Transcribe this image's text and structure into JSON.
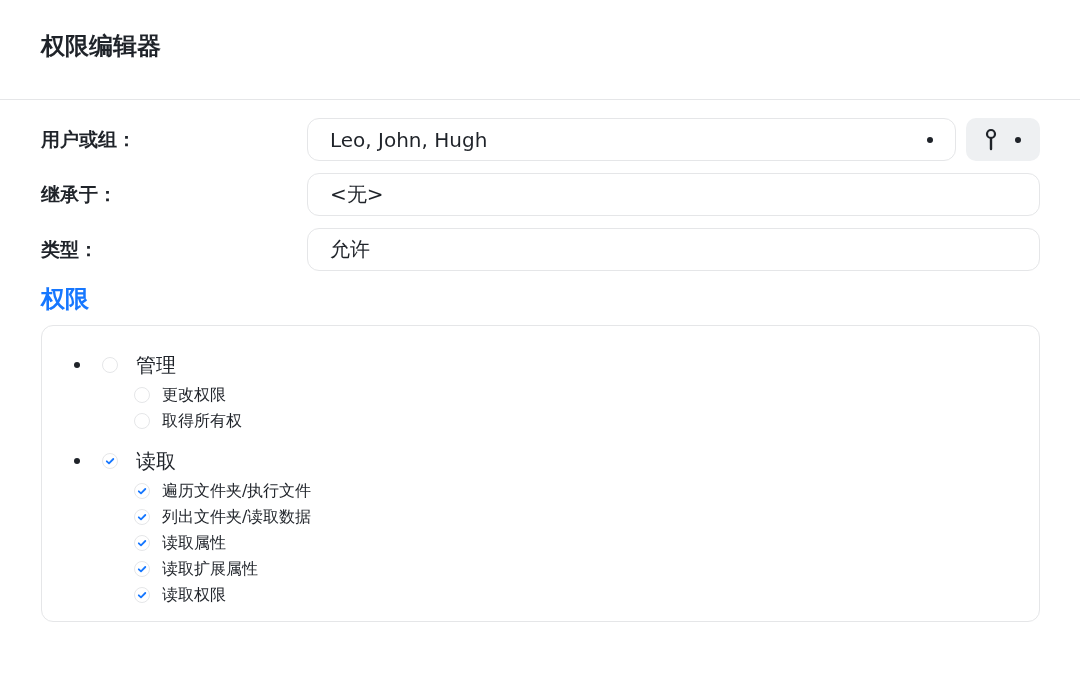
{
  "window": {
    "title": "权限编辑器"
  },
  "fields": [
    {
      "label": "用户或组：",
      "value": "Leo, John, Hugh",
      "kind": "picker"
    },
    {
      "label": "继承于：",
      "value": "<无>",
      "kind": "text"
    },
    {
      "label": "类型：",
      "value": "允许",
      "kind": "text"
    }
  ],
  "section": {
    "title": "权限"
  },
  "permissions": [
    {
      "label": "管理",
      "checked": false,
      "children": [
        {
          "label": "更改权限",
          "checked": false
        },
        {
          "label": "取得所有权",
          "checked": false
        }
      ]
    },
    {
      "label": "读取",
      "checked": true,
      "children": [
        {
          "label": "遍历文件夹/执行文件",
          "checked": true
        },
        {
          "label": "列出文件夹/读取数据",
          "checked": true
        },
        {
          "label": "读取属性",
          "checked": true
        },
        {
          "label": "读取扩展属性",
          "checked": true
        },
        {
          "label": "读取权限",
          "checked": true
        }
      ]
    }
  ]
}
